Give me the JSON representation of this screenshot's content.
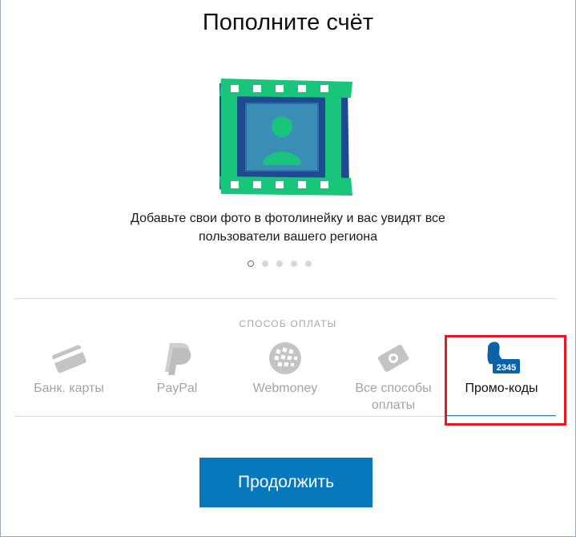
{
  "header": {
    "title": "Пополните счёт"
  },
  "promo": {
    "line1": "Добавьте свои фото в фотолинейку и вас увидят все",
    "line2": "пользователи вашего региона",
    "icon": "filmstrip-person-icon"
  },
  "carousel": {
    "total": 5,
    "active_index": 0
  },
  "payment": {
    "section_label": "СПОСОБ ОПЛАТЫ",
    "methods": [
      {
        "id": "cards",
        "label": "Банк. карты",
        "icon": "bank-card-icon",
        "selected": false
      },
      {
        "id": "paypal",
        "label": "PayPal",
        "icon": "paypal-icon",
        "selected": false
      },
      {
        "id": "webmoney",
        "label": "Webmoney",
        "icon": "webmoney-icon",
        "selected": false
      },
      {
        "id": "all",
        "label_line1": "Все способы",
        "label_line2": "оплаты",
        "icon": "money-icon",
        "selected": false
      },
      {
        "id": "promo",
        "label": "Промо-коды",
        "icon": "promo-code-icon",
        "icon_text": "2345",
        "selected": true
      }
    ]
  },
  "actions": {
    "continue_label": "Продолжить"
  },
  "colors": {
    "accent": "#0878bd",
    "highlight": "#e01b24",
    "film_green": "#19c47b",
    "film_blue": "#1e4a8f"
  }
}
